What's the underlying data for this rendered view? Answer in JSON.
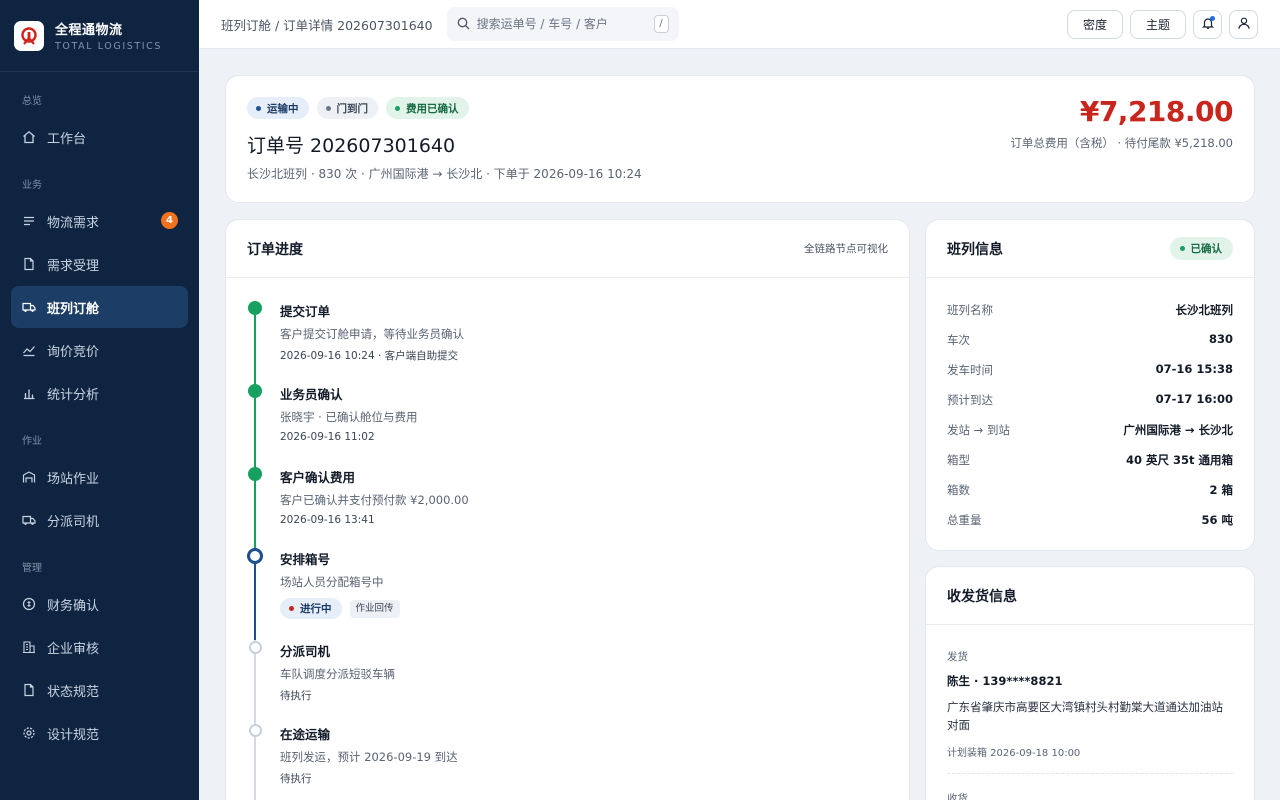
{
  "brand": {
    "name": "全程通物流",
    "subtitle": "TOTAL LOGISTICS"
  },
  "sidebar": {
    "groups": [
      {
        "label": "总览"
      },
      {
        "label": "业务"
      },
      {
        "label": "作业"
      },
      {
        "label": "管理"
      }
    ],
    "items": [
      {
        "label": "工作台",
        "icon": "home-icon"
      },
      {
        "label": "物流需求",
        "icon": "list-icon",
        "badge": "4"
      },
      {
        "label": "需求受理",
        "icon": "document-icon"
      },
      {
        "label": "班列订舱",
        "icon": "truck-icon",
        "active": true
      },
      {
        "label": "询价竞价",
        "icon": "trend-icon"
      },
      {
        "label": "统计分析",
        "icon": "bar-chart-icon"
      },
      {
        "label": "场站作业",
        "icon": "warehouse-icon"
      },
      {
        "label": "分派司机",
        "icon": "truck-icon"
      },
      {
        "label": "财务确认",
        "icon": "coin-icon"
      },
      {
        "label": "企业审核",
        "icon": "building-icon"
      },
      {
        "label": "状态规范",
        "icon": "document-icon"
      },
      {
        "label": "设计规范",
        "icon": "gear-icon"
      }
    ]
  },
  "topbar": {
    "breadcrumb": "班列订舱 / 订单详情 202607301640",
    "search_placeholder": "搜索运单号 / 车号 / 客户",
    "search_shortcut": "/",
    "density_label": "密度",
    "theme_label": "主题"
  },
  "summary": {
    "chips": [
      "运输中",
      "门到门",
      "费用已确认"
    ],
    "order_title": "订单号 202607301640",
    "meta": "长沙北班列 · 830 次 · 广州国际港 → 长沙北 · 下单于 2026-09-16 10:24",
    "total": "¥7,218.00",
    "total_note": "订单总费用（含税） · 待付尾款 ¥5,218.00"
  },
  "progress": {
    "title": "订单进度",
    "right_note": "全链路节点可视化",
    "steps": [
      {
        "title": "提交订单",
        "desc": "客户提交订舱申请，等待业务员确认",
        "time": "2026-09-16 10:24 · 客户端自助提交",
        "status": "done"
      },
      {
        "title": "业务员确认",
        "desc": "张晓宇 · 已确认舱位与费用",
        "time": "2026-09-16 11:02",
        "status": "done"
      },
      {
        "title": "客户确认费用",
        "desc": "客户已确认并支付预付款 ¥2,000.00",
        "time": "2026-09-16 13:41",
        "status": "done"
      },
      {
        "title": "安排箱号",
        "desc": "场站人员分配箱号中",
        "live_label": "进行中",
        "tag": "作业回传",
        "status": "current"
      },
      {
        "title": "分派司机",
        "desc": "车队调度分派短驳车辆",
        "time": "待执行",
        "status": "pending"
      },
      {
        "title": "在途运输",
        "desc": "班列发运，预计 2026-09-19 到达",
        "time": "待执行",
        "status": "pending"
      }
    ]
  },
  "train": {
    "title": "班列信息",
    "status": "已确认",
    "rows": [
      {
        "k": "班列名称",
        "v": "长沙北班列"
      },
      {
        "k": "车次",
        "v": "830"
      },
      {
        "k": "发车时间",
        "v": "07-16 15:38"
      },
      {
        "k": "预计到达",
        "v": "07-17 16:00"
      },
      {
        "k": "发站 → 到站",
        "v": "广州国际港 → 长沙北"
      },
      {
        "k": "箱型",
        "v": "40 英尺 35t 通用箱"
      },
      {
        "k": "箱数",
        "v": "2 箱"
      },
      {
        "k": "总重量",
        "v": "56 吨"
      }
    ]
  },
  "shipping": {
    "title": "收发货信息",
    "sender_label": "发货",
    "sender_contact": "陈生 · 139****8821",
    "sender_address": "广东省肇庆市高要区大湾镇村头村勤棠大道通达加油站对面",
    "sender_plan": "计划装箱 2026-09-18 10:00",
    "receiver_label": "收货"
  },
  "colors": {
    "accent": "#1d4f91",
    "success": "#16a160",
    "danger": "#c8261d",
    "sidebar": "#0f2440"
  }
}
